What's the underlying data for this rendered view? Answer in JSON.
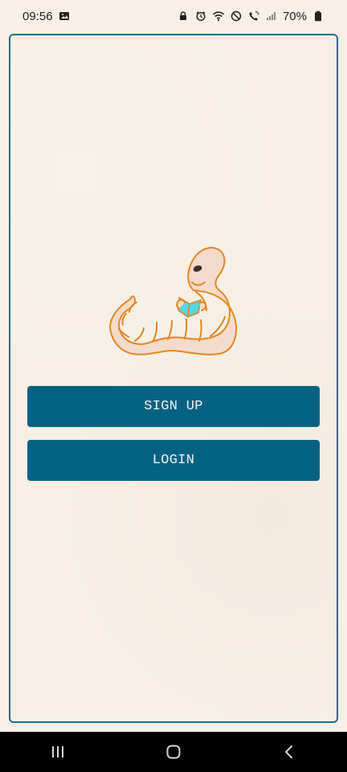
{
  "status": {
    "time": "09:56",
    "battery": "70%",
    "icons": [
      "image-icon",
      "lock-icon",
      "alarm-icon",
      "wifi-icon",
      "do-not-disturb-icon",
      "wifi-calling-icon",
      "signal-icon",
      "battery-icon"
    ]
  },
  "auth": {
    "signup_label": "SIGN UP",
    "login_label": "LOGIN"
  },
  "colors": {
    "accent": "#066283",
    "frame": "#1c6f8e",
    "background": "#f7efe5",
    "worm_outline": "#e38622",
    "worm_fill": "#f4dbcb",
    "book": "#55d7e2"
  },
  "nav": {
    "icons": [
      "recent-apps-icon",
      "home-icon",
      "back-icon"
    ]
  }
}
